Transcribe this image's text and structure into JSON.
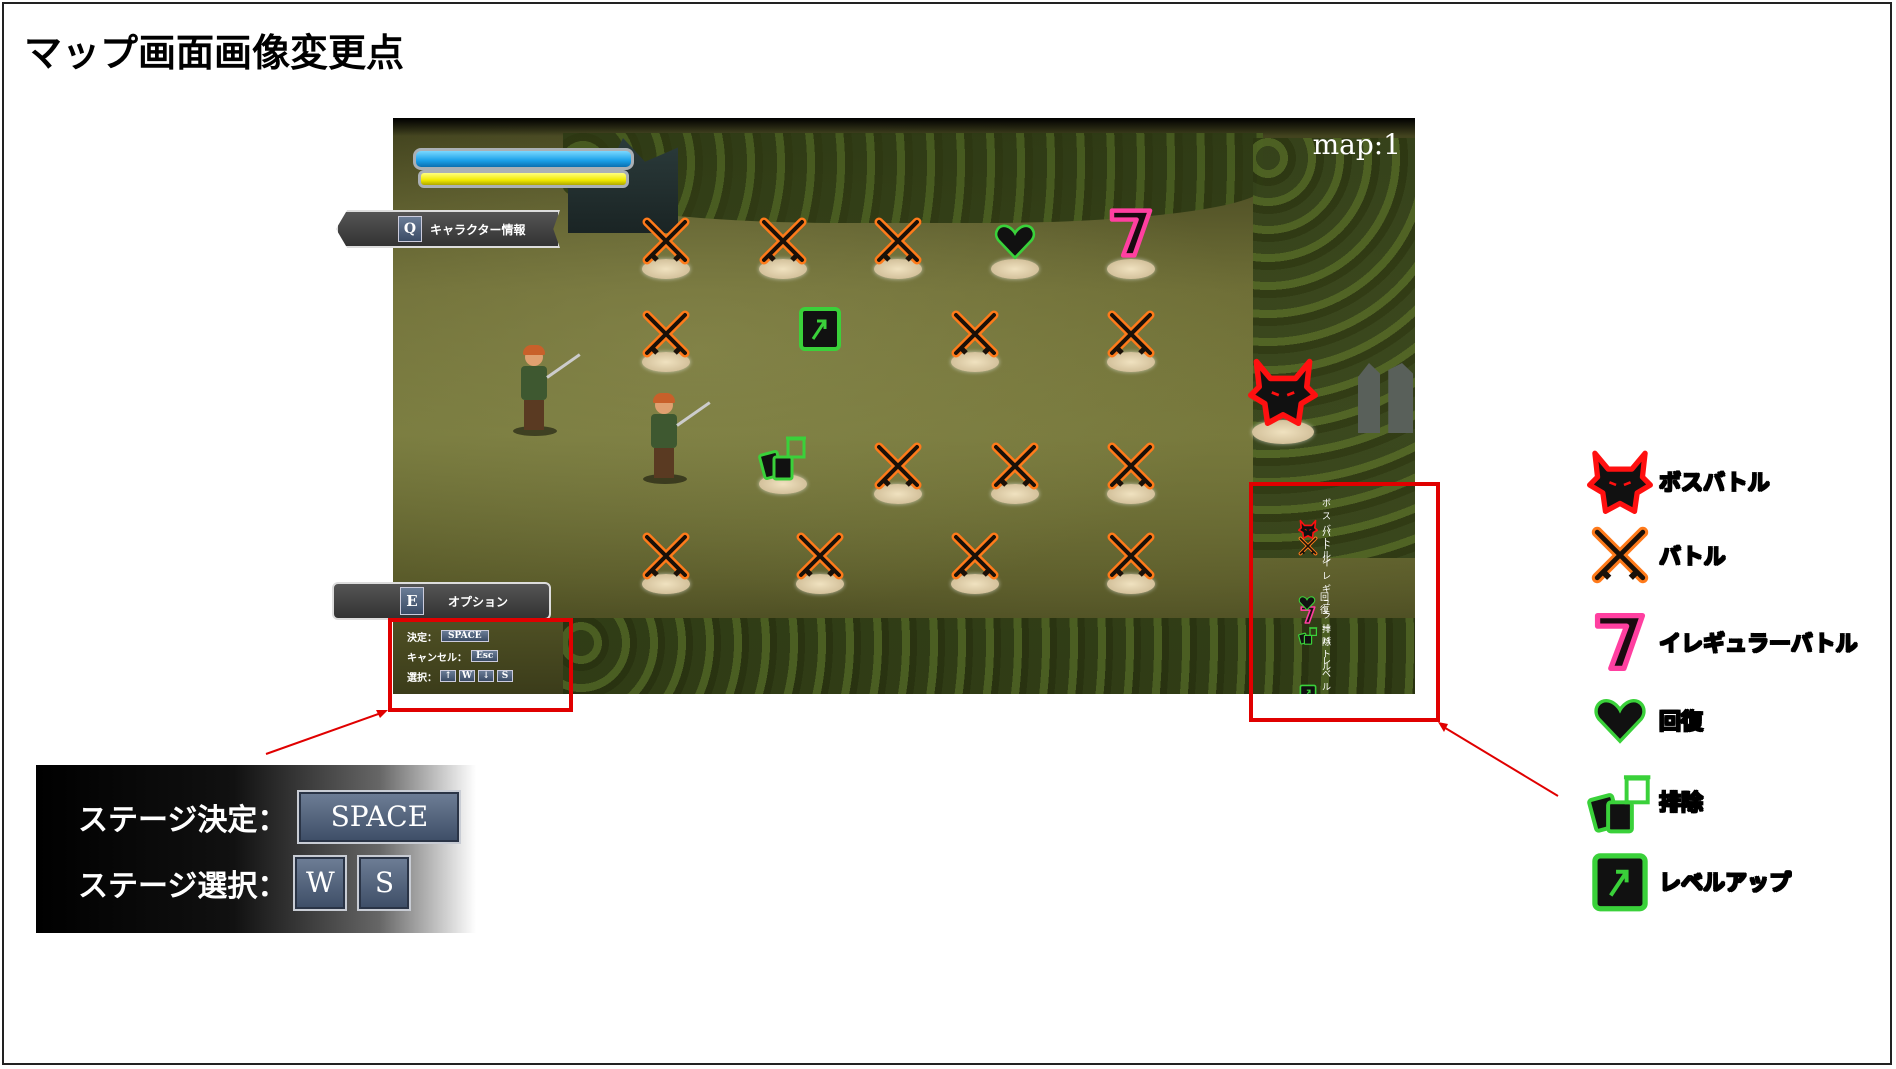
{
  "page": {
    "title": "マップ画面画像変更点"
  },
  "game": {
    "map_label": "map:1",
    "buttons": {
      "character": {
        "key": "Q",
        "label": "キャラクター情報"
      },
      "option": {
        "key": "E",
        "label": "オプション"
      }
    },
    "controls": {
      "confirm_label": "決定：",
      "confirm_key": "SPACE",
      "cancel_label": "キャンセル：",
      "cancel_key": "Esc",
      "select_label": "選択：",
      "select_keys": [
        "↑",
        "W",
        "↓",
        "S"
      ]
    },
    "legend": [
      {
        "icon": "demon-icon",
        "label": "ボスバトル"
      },
      {
        "icon": "crossed-swords-icon",
        "label": "バトル"
      },
      {
        "icon": "seven-icon",
        "label": "イレギュラーバトル"
      },
      {
        "icon": "heart-icon",
        "label": "回復"
      },
      {
        "icon": "trash-cards-icon",
        "label": "排除"
      },
      {
        "icon": "levelup-card-icon",
        "label": "レベルアップ"
      }
    ],
    "nodes": [
      {
        "type": "battle"
      },
      {
        "type": "battle"
      },
      {
        "type": "battle"
      },
      {
        "type": "heal"
      },
      {
        "type": "irregular"
      },
      {
        "type": "battle"
      },
      {
        "type": "levelup"
      },
      {
        "type": "battle"
      },
      {
        "type": "battle"
      },
      {
        "type": "boss"
      },
      {
        "type": "remove"
      },
      {
        "type": "battle"
      },
      {
        "type": "battle"
      },
      {
        "type": "battle"
      },
      {
        "type": "battle"
      },
      {
        "type": "battle"
      },
      {
        "type": "battle"
      },
      {
        "type": "battle"
      }
    ]
  },
  "zoom_controls": {
    "confirm_label": "ステージ決定：",
    "confirm_key": "SPACE",
    "select_label": "ステージ選択：",
    "select_keys": [
      "W",
      "S"
    ]
  },
  "big_legend": [
    {
      "icon": "demon-icon",
      "label": "ボスバトル"
    },
    {
      "icon": "crossed-swords-icon",
      "label": "バトル"
    },
    {
      "icon": "seven-icon",
      "label": "イレギュラーバトル"
    },
    {
      "icon": "heart-icon",
      "label": "回復"
    },
    {
      "icon": "trash-cards-icon",
      "label": "排除"
    },
    {
      "icon": "levelup-card-icon",
      "label": "レベルアップ"
    }
  ],
  "colors": {
    "battle_glow": "#ff7a1a",
    "boss_glow": "#ff1010",
    "irregular": "#e0307a",
    "green_glow": "#3ad13a",
    "annotation": "#e00000"
  }
}
